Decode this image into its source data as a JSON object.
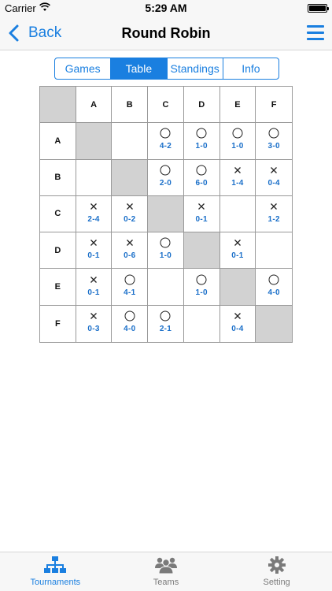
{
  "status_bar": {
    "carrier": "Carrier",
    "time": "5:29 AM"
  },
  "nav": {
    "back_label": "Back",
    "title": "Round Robin"
  },
  "segments": [
    {
      "label": "Games",
      "active": false
    },
    {
      "label": "Table",
      "active": true
    },
    {
      "label": "Standings",
      "active": false
    },
    {
      "label": "Info",
      "active": false
    }
  ],
  "table": {
    "teams": [
      "A",
      "B",
      "C",
      "D",
      "E",
      "F"
    ],
    "rows": [
      [
        null,
        {
          "mark": "",
          "score": ""
        },
        {
          "mark": "win",
          "score": "4-2"
        },
        {
          "mark": "win",
          "score": "1-0"
        },
        {
          "mark": "win",
          "score": "1-0"
        },
        {
          "mark": "win",
          "score": "3-0"
        }
      ],
      [
        {
          "mark": "",
          "score": ""
        },
        null,
        {
          "mark": "win",
          "score": "2-0"
        },
        {
          "mark": "win",
          "score": "6-0"
        },
        {
          "mark": "loss",
          "score": "1-4"
        },
        {
          "mark": "loss",
          "score": "0-4"
        }
      ],
      [
        {
          "mark": "loss",
          "score": "2-4"
        },
        {
          "mark": "loss",
          "score": "0-2"
        },
        null,
        {
          "mark": "loss",
          "score": "0-1"
        },
        {
          "mark": "",
          "score": ""
        },
        {
          "mark": "loss",
          "score": "1-2"
        }
      ],
      [
        {
          "mark": "loss",
          "score": "0-1"
        },
        {
          "mark": "loss",
          "score": "0-6"
        },
        {
          "mark": "win",
          "score": "1-0"
        },
        null,
        {
          "mark": "loss",
          "score": "0-1"
        },
        {
          "mark": "",
          "score": ""
        }
      ],
      [
        {
          "mark": "loss",
          "score": "0-1"
        },
        {
          "mark": "win",
          "score": "4-1"
        },
        {
          "mark": "",
          "score": ""
        },
        {
          "mark": "win",
          "score": "1-0"
        },
        null,
        {
          "mark": "win",
          "score": "4-0"
        }
      ],
      [
        {
          "mark": "loss",
          "score": "0-3"
        },
        {
          "mark": "win",
          "score": "4-0"
        },
        {
          "mark": "win",
          "score": "2-1"
        },
        {
          "mark": "",
          "score": ""
        },
        {
          "mark": "loss",
          "score": "0-4"
        },
        null
      ]
    ]
  },
  "tabs": [
    {
      "label": "Tournaments",
      "icon": "tournament-bracket-icon",
      "active": true
    },
    {
      "label": "Teams",
      "icon": "team-people-icon",
      "active": false
    },
    {
      "label": "Setting",
      "icon": "gear-icon",
      "active": false
    }
  ],
  "colors": {
    "accent": "#1a7fe0",
    "score": "#1a6fc9",
    "diagonal": "#d2d2d2"
  }
}
